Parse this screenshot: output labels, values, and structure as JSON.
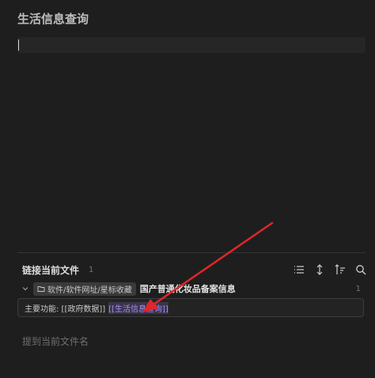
{
  "note": {
    "title": "生活信息查询"
  },
  "backlinks": {
    "title": "链接当前文件",
    "count": "1",
    "tools": [
      "list-icon",
      "expand-collapse-icon",
      "sort-icon",
      "search-icon"
    ],
    "file": {
      "folder_tag": "软件/软件网址/星标收藏",
      "name": "国产普通化妆品备案信息",
      "count": "1"
    },
    "snippet": {
      "prefix": "主要功能: [[政府数据]]",
      "link": "[[生活信息查询]]"
    }
  },
  "unlinked": {
    "title": "提到当前文件名"
  },
  "colors": {
    "background": "#1e1e1e",
    "link": "#a78bfa",
    "annotation_arrow": "#e0262a"
  }
}
